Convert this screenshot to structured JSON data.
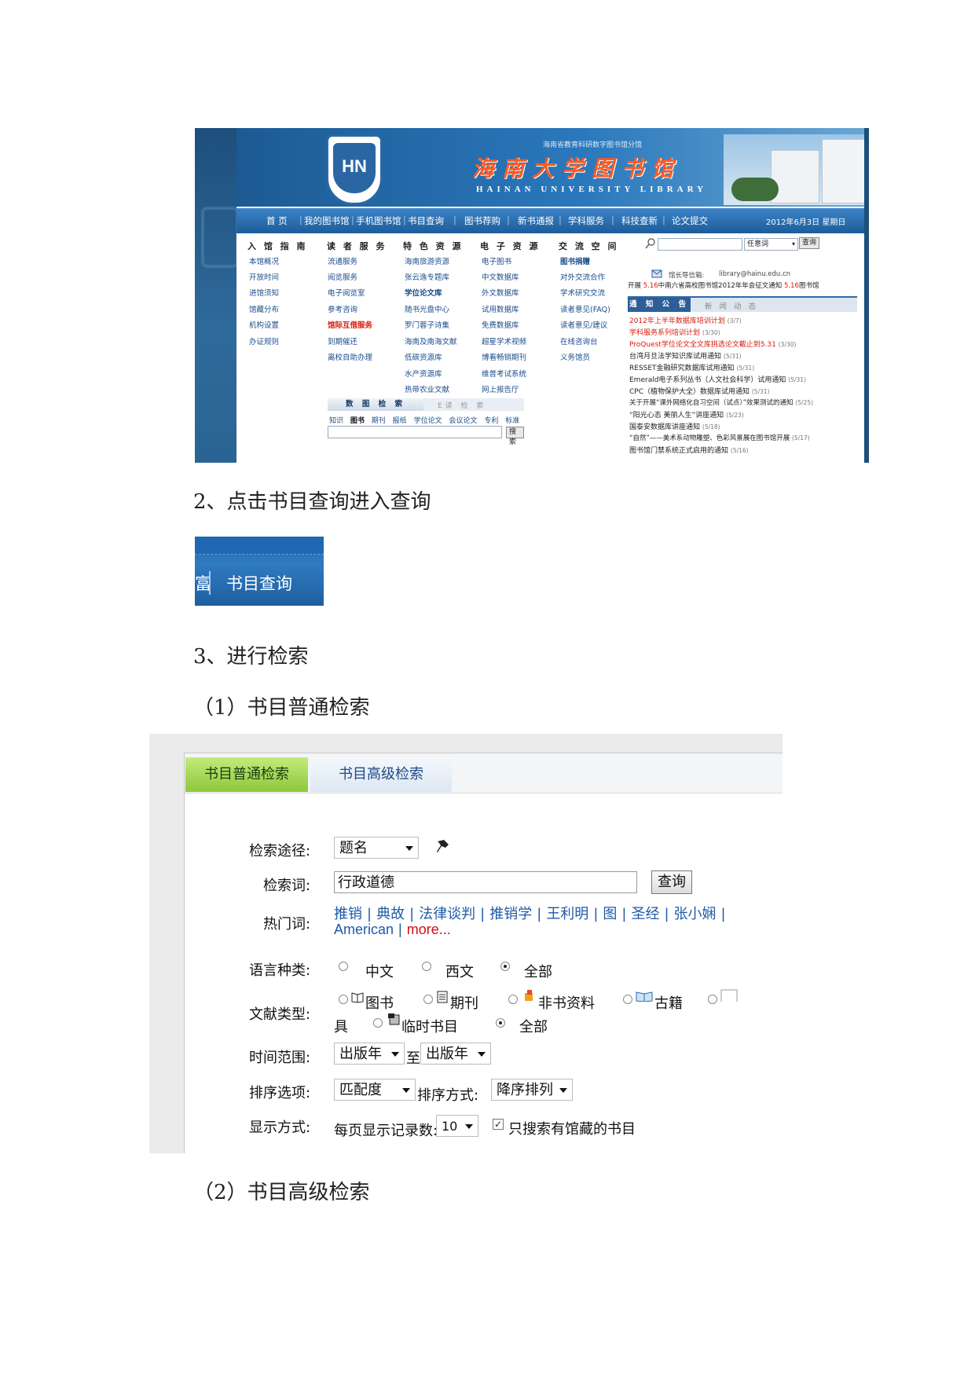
{
  "library": {
    "top_tag": "海南省教育科研数字图书馆分馆",
    "title_cn": "海南大学图书馆",
    "title_en": "HAINAN UNIVERSITY LIBRARY",
    "logo_text": "HN",
    "nav": [
      "首 页",
      "我的图书馆",
      "手机图书馆",
      "书目查询",
      "图书荐购",
      "新书通报",
      "学科服务",
      "科技查新",
      "论文提交"
    ],
    "date": "2012年6月3日 星期日",
    "columns": [
      {
        "title": "入 馆 指 南",
        "items": [
          "本馆概况",
          "开放时间",
          "进馆须知",
          "馆藏分布",
          "机构设置",
          "办证规则"
        ]
      },
      {
        "title": "读 者 服 务",
        "items": [
          "流通服务",
          "阅览服务",
          "电子阅览室",
          "参考咨询",
          "馆际互借服务",
          "到期催还",
          "离校自助办理"
        ]
      },
      {
        "title": "特 色 资 源",
        "items": [
          "海南旅游资源",
          "张云逸专题库",
          "学位论文库",
          "随书光盘中心",
          "罗门蓉子诗集",
          "海南及南海文献",
          "低碳资源库",
          "水产资源库",
          "热带农业文献"
        ]
      },
      {
        "title": "电 子 资 源",
        "items": [
          "电子图书",
          "中文数据库",
          "外文数据库",
          "试用数据库",
          "免费数据库",
          "超星学术视频",
          "博看畅销期刊",
          "维普考试系统",
          "网上报告厅"
        ]
      },
      {
        "title": "交 流 空 间",
        "items": [
          "图书捐赠",
          "对外交流合作",
          "学术研究交流",
          "读者意见(FAQ)",
          "读者意见/建议",
          "在线咨询台",
          "义务馆员"
        ]
      }
    ],
    "search_select": "任意词",
    "search_button": "查询",
    "guide_label": "馆长导信箱:",
    "guide_email": "library@hainu.edu.cn",
    "marquee_a": "开展",
    "marquee_b_date": "5.16",
    "marquee_b_text": "中南六省高校图书馆2012年年会征文通知",
    "marquee_c_date": "5.16",
    "marquee_c_text": "图书馆",
    "notice_tab": "通 知 公 告",
    "news_tab": "新 闻 动 态",
    "notices": [
      {
        "text": "2012年上半年数据库培训计划",
        "date": "(3/7)",
        "red": true
      },
      {
        "text": "学科服务系列培训计划",
        "date": "(3/30)",
        "red": true
      },
      {
        "text": "ProQuest学位论文全文库挑选论文截止到5.31",
        "date": "(3/30)",
        "red": true
      },
      {
        "text": "台湾月旦法学知识库试用通知",
        "date": "(5/31)",
        "red": false
      },
      {
        "text": "RESSET金融研究数据库试用通知",
        "date": "(5/31)",
        "red": false
      },
      {
        "text": "Emerald电子系列丛书（人文社会科学）试用通知",
        "date": "(5/31)",
        "red": false
      },
      {
        "text": "CPC（植物保护大全）数据库试用通知",
        "date": "(5/31)",
        "red": false
      },
      {
        "text": "关于开展“课外网络化自习空间（试点）”效果测试的通知",
        "date": "(5/25)",
        "red": false
      },
      {
        "text": "“阳光心态 美丽人生”讲座通知",
        "date": "(5/23)",
        "red": false
      },
      {
        "text": "国泰安数据库讲座通知",
        "date": "(5/18)",
        "red": false
      },
      {
        "text": "“自然”——美术系动物雕塑、色彩风景展在图书馆开展",
        "date": "(5/17)",
        "red": false
      },
      {
        "text": "图书馆门禁系统正式启用的通知",
        "date": "(5/16)",
        "red": false
      }
    ],
    "db_tab_a": "数 图 检 索",
    "db_tab_b": "E读 检 索",
    "db_types": [
      "知识",
      "图书",
      "期刊",
      "报纸",
      "学位论文",
      "会议论文",
      "专利",
      "标准"
    ],
    "db_search_btn": "搜索"
  },
  "paragraphs": {
    "step2": "2、点击书目查询进入查询",
    "step3": "3、进行检索",
    "sub1": "（1）书目普通检索",
    "sub2": "（2）书目高级检索"
  },
  "crop": {
    "fragment": "富",
    "label": "书目查询"
  },
  "search_form": {
    "tab_basic": "书目普通检索",
    "tab_advanced": "书目高级检索",
    "route_label": "检索途径:",
    "route_value": "题名",
    "term_label": "检索词:",
    "term_value": "行政道德",
    "query_button": "查询",
    "hot_label": "热门词:",
    "hot_words": [
      "推销",
      "典故",
      "法律谈判",
      "推销学",
      "王利明",
      "图",
      "圣经",
      "张小娴"
    ],
    "hot_line2_a": "American",
    "hot_line2_more": "more...",
    "lang_label": "语言种类:",
    "lang_options": [
      "中文",
      "西文",
      "全部"
    ],
    "doc_label": "文献类型:",
    "doc_options": [
      "图书",
      "期刊",
      "非书资料",
      "古籍"
    ],
    "doc_wrap": "具",
    "doc_options2": [
      "临时书目",
      "全部"
    ],
    "time_label": "时间范围:",
    "time_from": "出版年",
    "time_to_word": "至",
    "time_to": "出版年",
    "sort_label": "排序选项:",
    "sort_value": "匹配度",
    "sort_mode_label": "排序方式:",
    "sort_mode_value": "降序排列",
    "display_label": "显示方式:",
    "per_page_label": "每页显示记录数:",
    "per_page_value": "10",
    "only_holdings": "只搜索有馆藏的书目"
  }
}
